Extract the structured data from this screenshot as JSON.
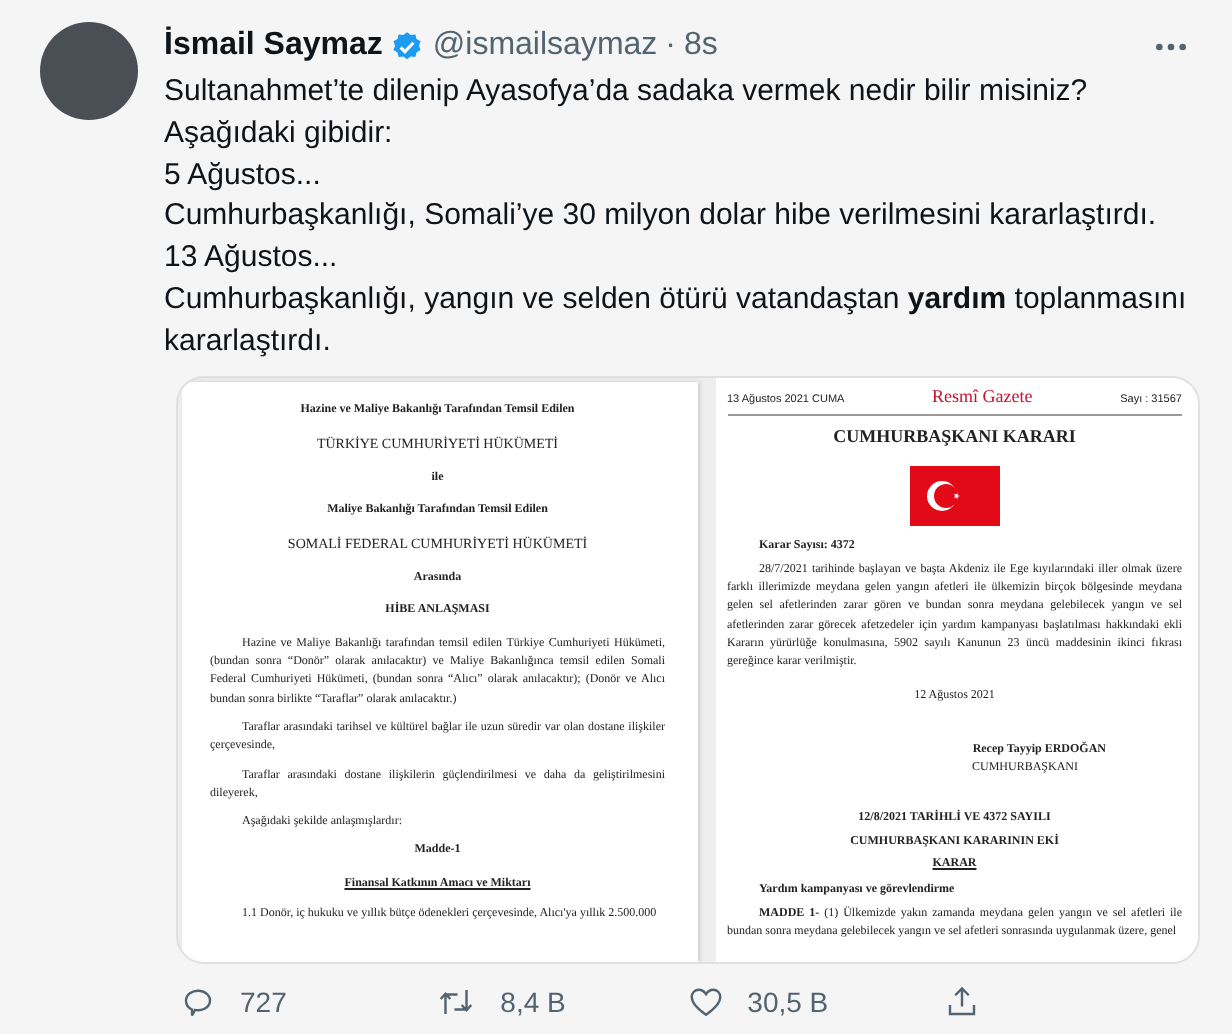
{
  "author": {
    "name": "İsmail Saymaz",
    "handle": "@ismailsaymaz",
    "separator": "·",
    "time": "8s"
  },
  "text": [
    "Sultanahmet’te dilenip Ayasofya’da sadaka vermek nedir bilir misiniz?",
    "Aşağıdaki gibidir:",
    "5 Ağustos...",
    "Cumhurbaşkanlığı, Somali’ye 30 milyon dolar hibe verilmesini kararlaştırdı.",
    "13 Ağustos...",
    "Cumhurbaşkanlığı, yangın ve selden ötürü vatandaştan **yardım** toplanmasını kararlaştırdı."
  ],
  "media": [
    {
      "kind": "agreement",
      "blocks": [
        {
          "kind": "title",
          "text": "Hazine ve Maliye Bakanlığı Tarafından Temsil Edilen"
        },
        {
          "kind": "caps",
          "text": "TÜRKİYE CUMHURİYETİ HÜKÜMETİ"
        },
        {
          "kind": "title",
          "text": "ile"
        },
        {
          "kind": "title",
          "text": "Maliye Bakanlığı Tarafından Temsil Edilen"
        },
        {
          "kind": "caps",
          "text": "SOMALİ FEDERAL CUMHURİYETİ HÜKÜMETİ"
        },
        {
          "kind": "title",
          "text": "Arasında"
        },
        {
          "kind": "title",
          "text": "HİBE ANLAŞMASI"
        },
        {
          "kind": "para",
          "text": "Hazine ve Maliye Bakanlığı tarafından temsil edilen Türkiye Cumhuriyeti Hükümeti, (bundan sonra “Donör” olarak anılacaktır) ve Maliye Bakanlığınca temsil edilen Somali Federal Cumhuriyeti Hükümeti, (bundan sonra “Alıcı” olarak anılacaktır); (Donör ve Alıcı bundan sonra birlikte “Taraflar” olarak anılacaktır.)"
        },
        {
          "kind": "para",
          "text": "Taraflar arasındaki tarihsel ve kültürel bağlar ile uzun süredir var olan dostane ilişkiler çerçevesinde,"
        },
        {
          "kind": "para",
          "text": "Taraflar arasındaki dostane ilişkilerin güçlendirilmesi ve daha da geliştirilmesini dileyerek,"
        },
        {
          "kind": "para",
          "text": "Aşağıdaki şekilde anlaşmışlardır:"
        },
        {
          "kind": "title",
          "text": "Madde-1"
        },
        {
          "kind": "underline",
          "text": "Finansal Katkının Amacı ve Miktarı"
        },
        {
          "kind": "para",
          "text": "1.1 Donör, iç hukuku ve yıllık bütçe ödenekleri çerçevesinde, Alıcı'ya yıllık 2.500.000"
        }
      ]
    },
    {
      "kind": "gazette",
      "blocks": [
        {
          "kind": "header",
          "date": "13 Ağustos 2021 CUMA",
          "name": "Resmî Gazete",
          "number": "Sayı : 31567"
        },
        {
          "kind": "caps",
          "text": "CUMHURBAŞKANI KARARI"
        },
        {
          "kind": "flag"
        },
        {
          "kind": "label",
          "text": "Karar Sayısı: 4372"
        },
        {
          "kind": "para",
          "text": "28/7/2021 tarihinde başlayan ve başta Akdeniz ile Ege kıyılarındaki iller olmak üzere farklı illerimizde meydana gelen yangın afetleri ile ülkemizin birçok bölgesinde meydana gelen sel afetlerinden zarar gören ve bundan sonra meydana gelebilecek yangın ve sel afetlerinden zarar görecek afetzedeler için yardım kampanyası başlatılması hakkındaki ekli Kararın yürürlüğe konulmasına, 5902 sayılı Kanunun 23 üncü maddesinin ikinci fıkrası gereğince karar verilmiştir."
        },
        {
          "kind": "date",
          "text": "12 Ağustos 2021"
        },
        {
          "kind": "sign",
          "text": "Recep Tayyip ERDOĞAN"
        },
        {
          "kind": "office",
          "text": "CUMHURBAŞKANI"
        },
        {
          "kind": "title",
          "text": "12/8/2021 TARİHLİ VE 4372 SAYILI"
        },
        {
          "kind": "title",
          "text": "CUMHURBAŞKANI KARARININ EKİ"
        },
        {
          "kind": "underline",
          "text": "KARAR"
        },
        {
          "kind": "label",
          "text": "Yardım kampanyası ve görevlendirme"
        },
        {
          "kind": "para",
          "text": "**MADDE 1-** (1) Ülkemizde yakın zamanda meydana gelen yangın ve sel afetleri ile bundan sonra meydana gelebilecek yangın ve sel afetleri sonrasında uygulanmak üzere, genel"
        }
      ]
    }
  ],
  "actions": [
    {
      "kind": "reply",
      "count": "727"
    },
    {
      "kind": "retweet",
      "count": "8,4 B"
    },
    {
      "kind": "like",
      "count": "30,5 B"
    },
    {
      "kind": "share"
    }
  ]
}
